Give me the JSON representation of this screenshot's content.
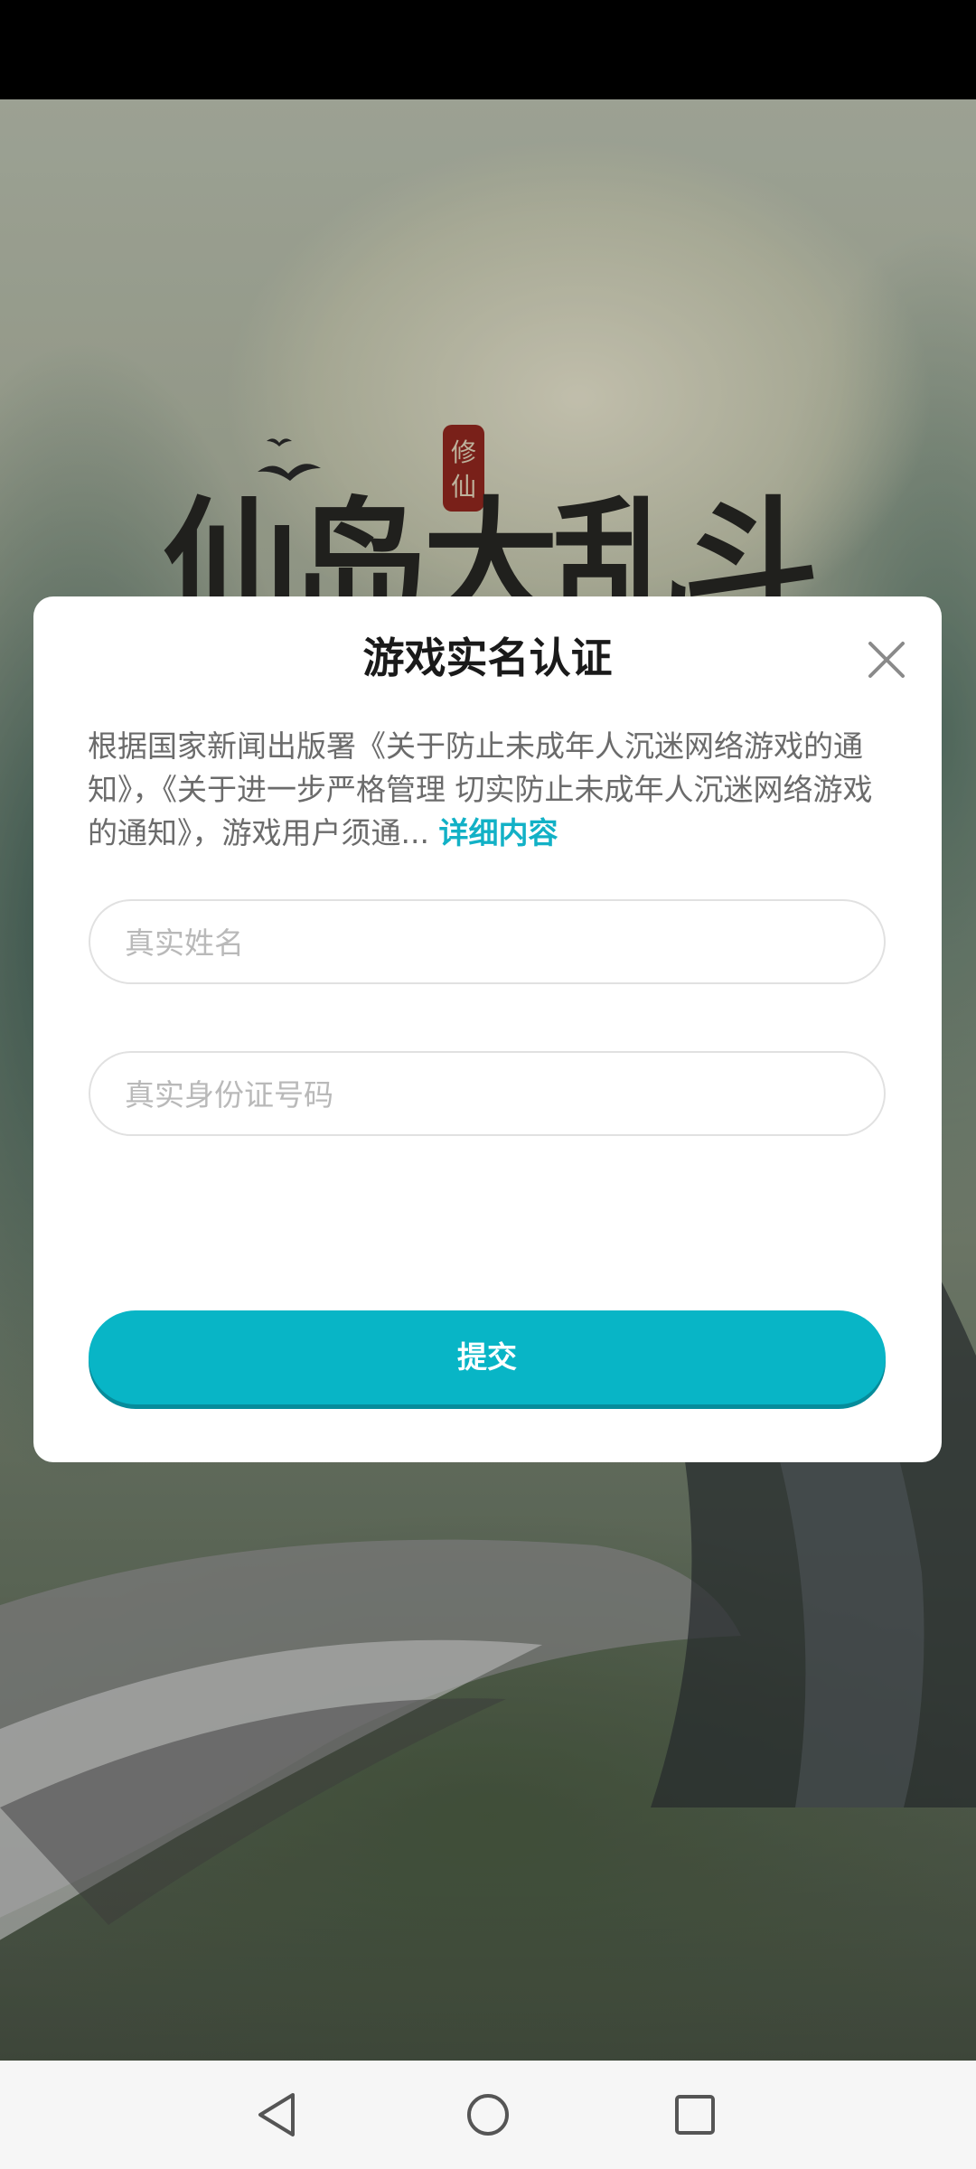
{
  "game": {
    "logo_text": "仙岛大乱斗",
    "seal_text": "修仙"
  },
  "dialog": {
    "title": "游戏实名认证",
    "notice_text": "根据国家新闻出版署《关于防止未成年人沉迷网络游戏的通知》，《关于进一步严格管理 切实防止未成年人沉迷网络游戏的通知》，游戏用户须通...",
    "details_link": "详细内容",
    "name_field": {
      "placeholder": "真实姓名",
      "value": ""
    },
    "id_field": {
      "placeholder": "真实身份证号码",
      "value": ""
    },
    "submit_label": "提交",
    "close_icon": "close-icon"
  },
  "nav": {
    "back_icon": "triangle-back-icon",
    "home_icon": "circle-home-icon",
    "recents_icon": "square-recents-icon"
  },
  "colors": {
    "accent": "#08b5c6",
    "link": "#12b1c6",
    "dialog_bg": "#ffffff",
    "field_border": "#e1e1e1"
  }
}
